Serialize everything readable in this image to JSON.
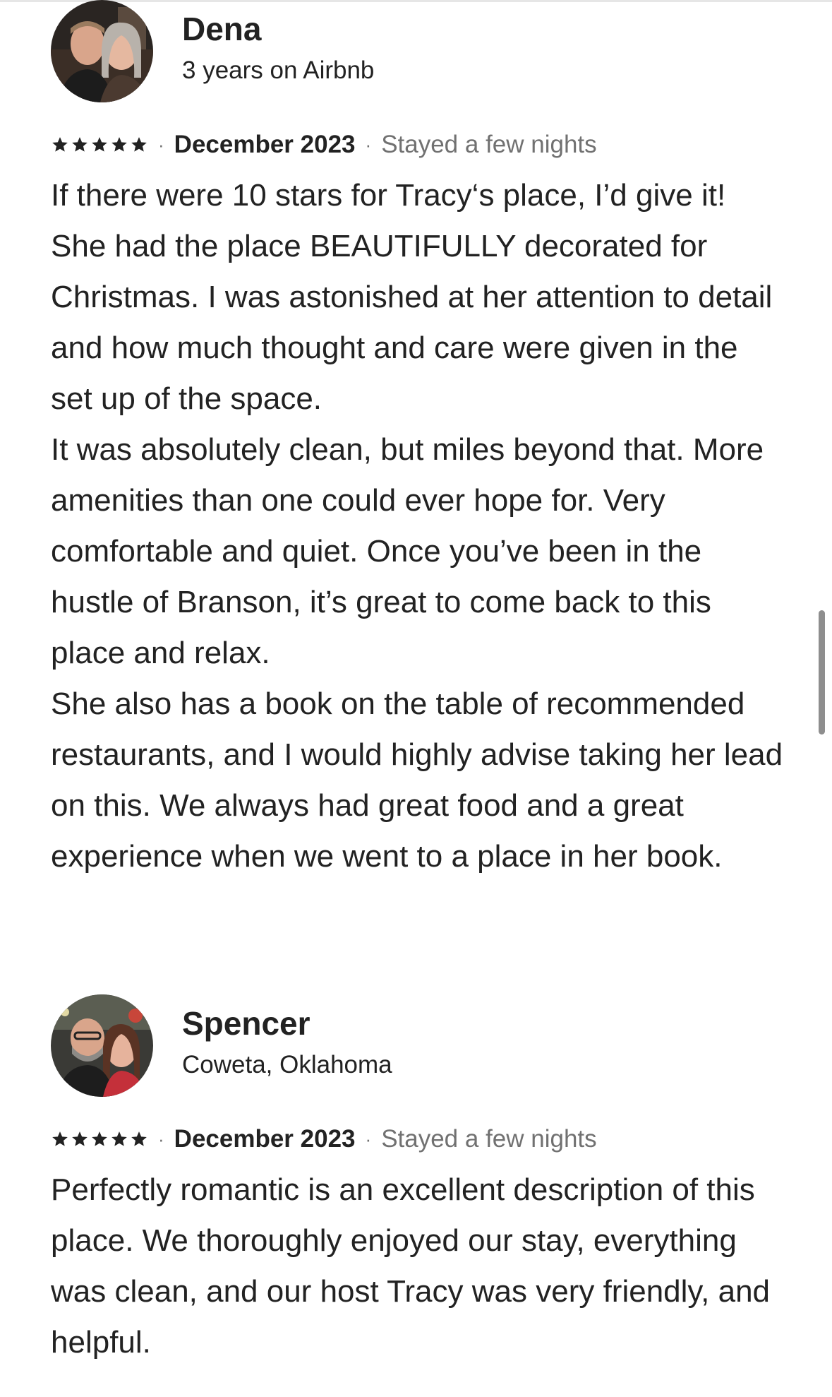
{
  "reviews": [
    {
      "name": "Dena",
      "subtitle": "3 years on Airbnb",
      "rating": 5,
      "date": "December 2023",
      "stay": "Stayed a few nights",
      "text": "If there were 10 stars for Tracy‘s place, I’d give it! She had the place BEAUTIFULLY decorated for Christmas. I was astonished at her attention to detail and how much thought and care were given in the set up of the space.\nIt was absolutely clean, but miles beyond that. More amenities than one could ever hope for. Very comfortable and quiet. Once you’ve been in the hustle of Branson, it’s great to come back to this place and relax.\nShe also has a book on the table of recommended restaurants, and I would highly advise taking her lead on this. We always had great food and a great experience when we went to a place in her book."
    },
    {
      "name": "Spencer",
      "subtitle": "Coweta, Oklahoma",
      "rating": 5,
      "date": "December 2023",
      "stay": "Stayed a few nights",
      "text": "Perfectly romantic is an excellent description of this place. We thoroughly enjoyed our stay, everything was clean, and our host Tracy was very friendly, and helpful."
    }
  ],
  "meta_separator": "·",
  "colors": {
    "primary_text": "#222222",
    "secondary_text": "#717171",
    "scrollbar": "#8e8e8e"
  },
  "icons": {
    "star": "star-icon"
  }
}
